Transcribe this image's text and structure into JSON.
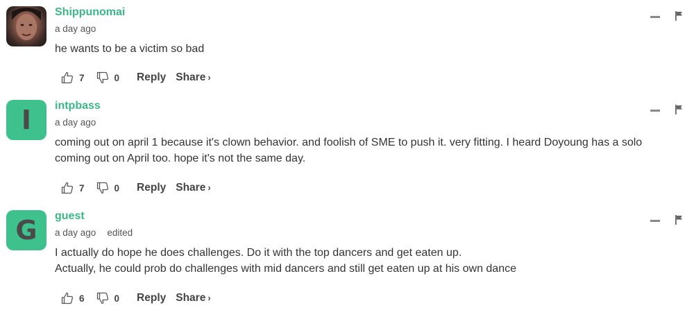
{
  "comments": [
    {
      "author": "Shippunomai",
      "time": "a day ago",
      "edited": "",
      "lines": [
        "he wants to be a victim so bad"
      ],
      "likes": "7",
      "dislikes": "0",
      "avatar_letter": ""
    },
    {
      "author": "intpbass",
      "time": "a day ago",
      "edited": "",
      "lines": [
        "coming out on april 1 because it's clown behavior. and foolish of SME to push it. very fitting. I heard Doyoung has a solo",
        "coming out on April too. hope it's not the same day."
      ],
      "likes": "7",
      "dislikes": "0",
      "avatar_letter": "I"
    },
    {
      "author": "guest",
      "time": "a day ago",
      "edited": "edited",
      "lines": [
        "I actually do hope he does challenges. Do it with the top dancers and get eaten up.",
        "Actually, he could prob do challenges with mid dancers and still get eaten up at his own dance"
      ],
      "likes": "6",
      "dislikes": "0",
      "avatar_letter": "G"
    }
  ],
  "labels": {
    "reply": "Reply",
    "share": "Share",
    "share_chevron": "›"
  },
  "colors": {
    "accent": "#3bb887",
    "avatar_bg": "#3ec18d"
  },
  "icons": [
    "thumbs-up-icon",
    "thumbs-down-icon",
    "collapse-icon",
    "flag-icon",
    "chevron-right-icon"
  ]
}
